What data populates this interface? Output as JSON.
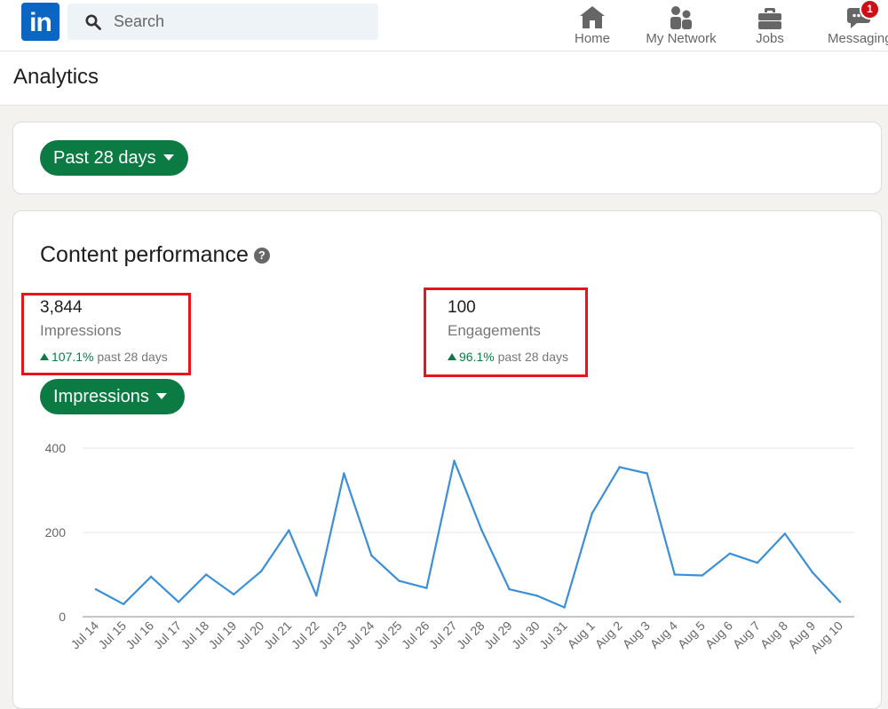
{
  "nav": {
    "logo_text": "in",
    "search_placeholder": "Search",
    "items": [
      {
        "label": "Home",
        "icon": "home-icon"
      },
      {
        "label": "My Network",
        "icon": "people-icon"
      },
      {
        "label": "Jobs",
        "icon": "briefcase-icon"
      },
      {
        "label": "Messaging",
        "icon": "messaging-icon",
        "badge": "1"
      }
    ]
  },
  "page": {
    "title": "Analytics"
  },
  "filter": {
    "date_range_label": "Past 28 days"
  },
  "content": {
    "title": "Content performance",
    "help_glyph": "?",
    "metrics": [
      {
        "value": "3,844",
        "name": "Impressions",
        "change": "107.1%",
        "period": "past 28 days"
      },
      {
        "value": "100",
        "name": "Engagements",
        "change": "96.1%",
        "period": "past 28 days"
      }
    ],
    "metric_selector_label": "Impressions"
  },
  "colors": {
    "brand": "#0a66c2",
    "accent_green": "#0b7a43",
    "line": "#3a8fd9",
    "highlight": "#e8141b"
  },
  "chart_data": {
    "type": "line",
    "categories": [
      "Jul 14",
      "Jul 15",
      "Jul 16",
      "Jul 17",
      "Jul 18",
      "Jul 19",
      "Jul 20",
      "Jul 21",
      "Jul 22",
      "Jul 23",
      "Jul 24",
      "Jul 25",
      "Jul 26",
      "Jul 27",
      "Jul 28",
      "Jul 29",
      "Jul 30",
      "Jul 31",
      "Aug 1",
      "Aug 2",
      "Aug 3",
      "Aug 4",
      "Aug 5",
      "Aug 6",
      "Aug 7",
      "Aug 8",
      "Aug 9",
      "Aug 10"
    ],
    "series": [
      {
        "values": [
          65,
          30,
          95,
          35,
          100,
          53,
          108,
          205,
          50,
          340,
          145,
          85,
          68,
          370,
          205,
          65,
          50,
          22,
          245,
          355,
          340,
          100,
          98,
          150,
          128,
          197,
          105,
          35
        ]
      }
    ],
    "yticks": [
      0,
      200,
      400
    ],
    "ylim": [
      0,
      420
    ],
    "grid": true,
    "legend": "none"
  }
}
